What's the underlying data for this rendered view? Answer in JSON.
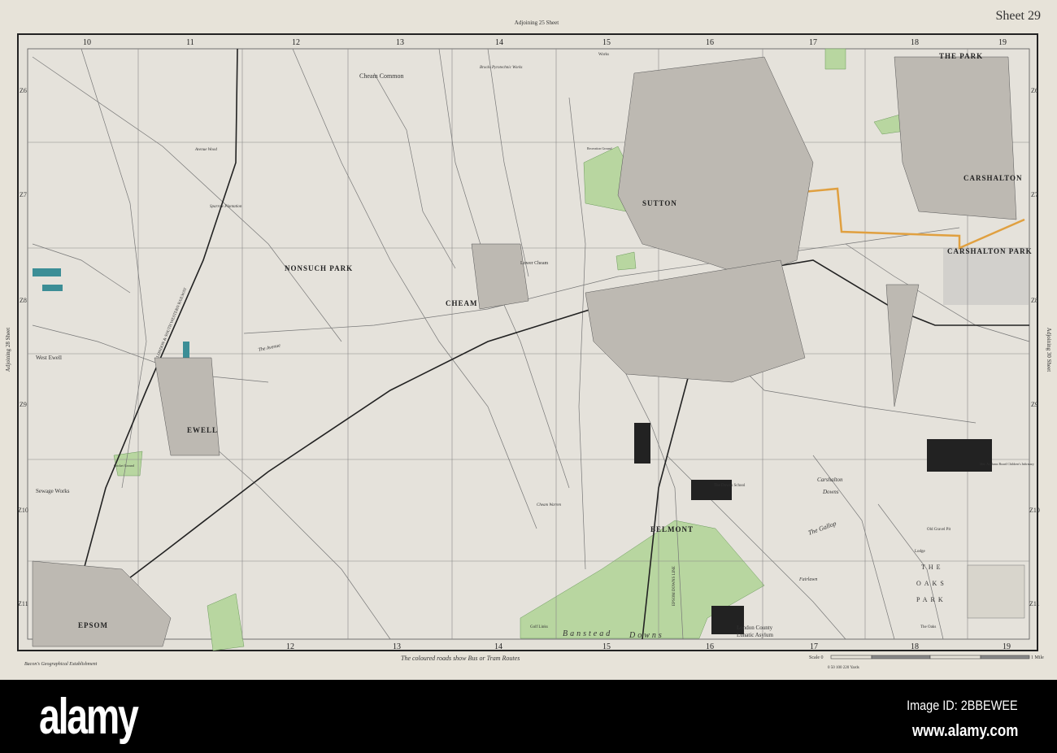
{
  "header": {
    "sheet": "Sheet 29",
    "adjoining_top": "Adjoining 25 Sheet",
    "adjoining_left": "Adjoining 28 Sheet",
    "adjoining_right": "Adjoining 30 Sheet"
  },
  "grid": {
    "columns": [
      "10",
      "11",
      "12",
      "13",
      "14",
      "15",
      "16",
      "17",
      "18",
      "19"
    ],
    "rows": [
      "Z6",
      "Z7",
      "Z8",
      "Z9",
      "Z10",
      "Z11"
    ]
  },
  "places": {
    "cheam_common": "Cheam Common",
    "nonsuch_park": "NONSUCH PARK",
    "cheam": "CHEAM",
    "lower_cheam": "Lower Cheam",
    "sutton": "SUTTON",
    "carshalton": "CARSHALTON",
    "carshalton_park": "CARSHALTON PARK",
    "the_park": "THE PARK",
    "ewell": "EWELL",
    "west_ewell": "West Ewell",
    "epsom": "EPSOM",
    "belmont": "BELMONT",
    "banstead": "Banstead",
    "downs": "Downs",
    "carshalton_downs_1": "Carshalton",
    "carshalton_downs_2": "Downs",
    "oaks_1": "THE",
    "oaks_2": "OAKS",
    "oaks_3": "PARK",
    "the_gallop": "The Gallop",
    "fairlawn": "Fairlawn",
    "sewage_works": "Sewage Works",
    "the_avenue": "The Avenue",
    "downs_school": "The Downs School",
    "asylum_1": "London County",
    "asylum_2": "Lunatic Asylum",
    "golf_links": "Golf Links",
    "cheam_warren": "Cheam Warren",
    "cricket_ground": "Cricket Ground",
    "recreation_ground": "Recreation Ground",
    "works": "Works",
    "brocks_works": "Brocks Pyrotechnic Works",
    "sparrow_plantation": "Sparrow Plantation",
    "avenue_wood": "Avenue Wood",
    "old_gravel_pit": "Old Gravel Pit",
    "lodge": "Lodge",
    "the_oaks": "The Oaks",
    "asylum_board": "Met. Asylums Board Children's Infirmary",
    "epsom_downs_line": "EPSOM DOWNS LINE",
    "lsw_railway": "LONDON & SOUTH WESTERN RAILWAY"
  },
  "footer": {
    "publisher": "Bacon's Geographical Establishment",
    "note": "The coloured roads show Bus or Tram Routes",
    "scale_label": "Scale 0",
    "scale_end": "1 Mile",
    "scale_yards": "0 50 100 220 Yards"
  },
  "watermark": {
    "logo": "alamy",
    "image_id": "Image ID: 2BBEWEE",
    "url": "www.alamy.com"
  },
  "colors": {
    "paper": "#e7e3d9",
    "green": "#b8d6a0",
    "bus_route": "#e0a040",
    "water": "#3c8e96"
  }
}
